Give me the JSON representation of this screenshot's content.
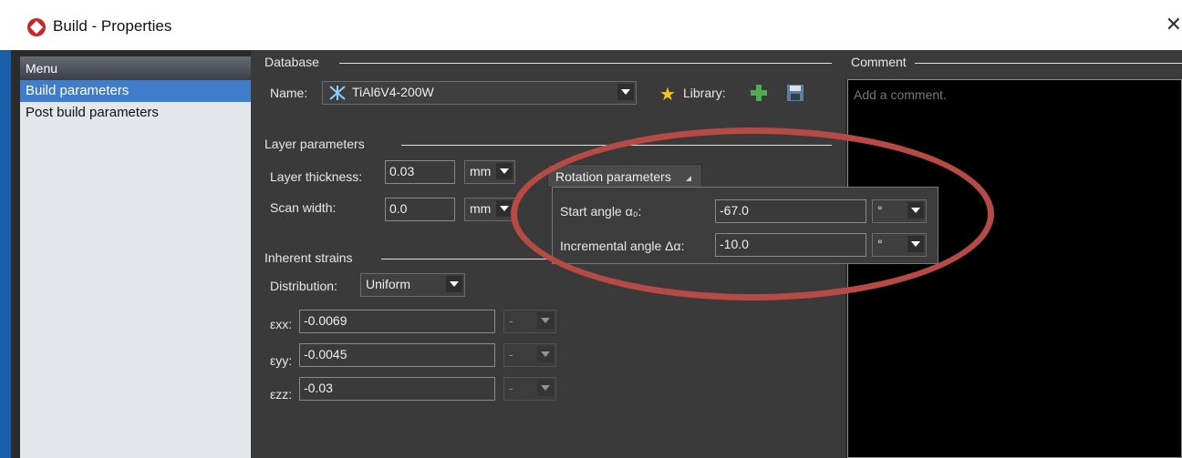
{
  "window": {
    "title": "Build - Properties",
    "close": "✕"
  },
  "menu": {
    "header": "Menu",
    "items": [
      {
        "label": "Build parameters",
        "selected": true
      },
      {
        "label": "Post build parameters",
        "selected": false
      }
    ]
  },
  "database": {
    "section": "Database",
    "name_label": "Name:",
    "name_value": "TiAl6V4-200W",
    "library_label": "Library:"
  },
  "layer": {
    "section": "Layer parameters",
    "thickness_label": "Layer thickness:",
    "thickness_value": "0.03",
    "thickness_unit": "mm",
    "scan_label": "Scan width:",
    "scan_value": "0.0",
    "scan_unit": "mm"
  },
  "rotation": {
    "tab_label": "Rotation parameters",
    "start_label": "Start angle α₀:",
    "start_value": "-67.0",
    "start_unit": "°",
    "incr_label": "Incremental angle Δα:",
    "incr_value": "-10.0",
    "incr_unit": "°"
  },
  "strains": {
    "section": "Inherent strains",
    "distribution_label": "Distribution:",
    "distribution_value": "Uniform",
    "rows": [
      {
        "label": "εxx:",
        "value": "-0.0069",
        "unit": "-"
      },
      {
        "label": "εyy:",
        "value": "-0.0045",
        "unit": "-"
      },
      {
        "label": "εzz:",
        "value": "-0.03",
        "unit": "-"
      }
    ]
  },
  "comment": {
    "section": "Comment",
    "placeholder": "Add a comment."
  },
  "colors": {
    "accent": "#1b5fa8",
    "selection": "#3f7cc9",
    "highlight_ellipse": "#b84a45"
  }
}
